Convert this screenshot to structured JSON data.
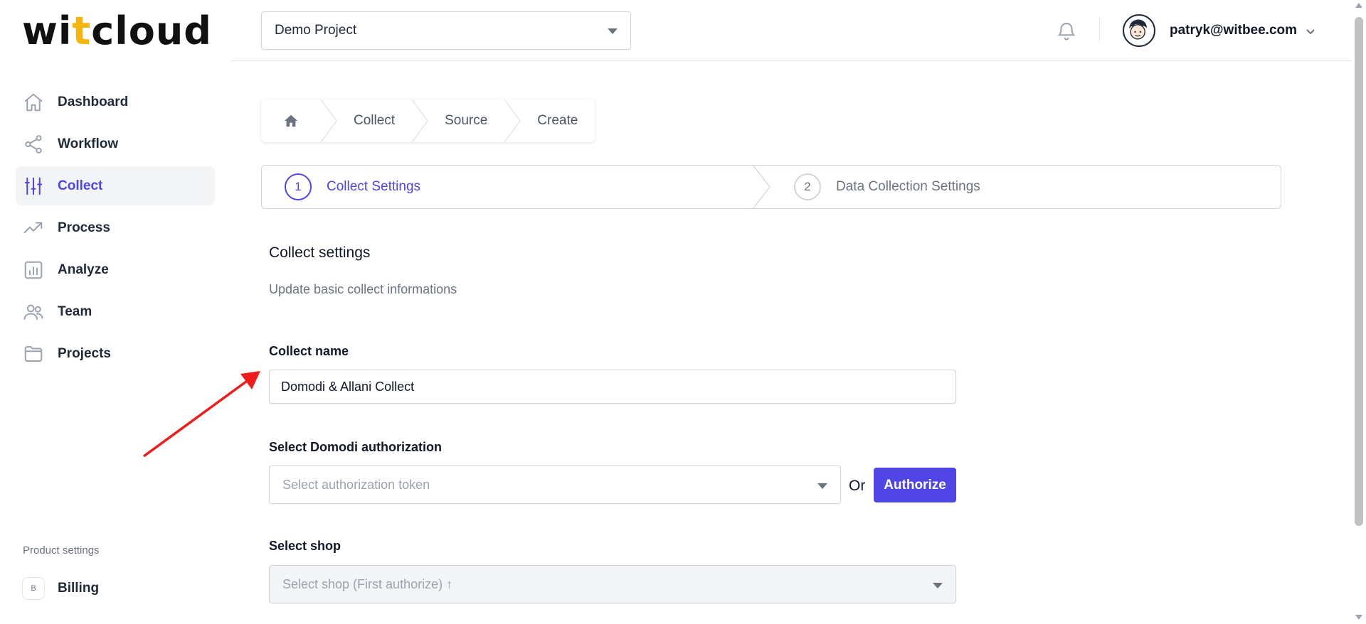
{
  "app": {
    "logo": {
      "prefix": "wi",
      "accent": "t",
      "suffix": "cloud"
    },
    "brand_color": "#4f46e5"
  },
  "header": {
    "project": "Demo Project",
    "user_email": "patryk@witbee.com"
  },
  "sidebar": {
    "items": [
      {
        "label": "Dashboard",
        "icon": "home-icon"
      },
      {
        "label": "Workflow",
        "icon": "share-icon"
      },
      {
        "label": "Collect",
        "icon": "sliders-icon",
        "active": true
      },
      {
        "label": "Process",
        "icon": "trending-up-icon"
      },
      {
        "label": "Analyze",
        "icon": "bar-chart-icon"
      },
      {
        "label": "Team",
        "icon": "users-icon"
      },
      {
        "label": "Projects",
        "icon": "folder-icon"
      }
    ],
    "product_settings_label": "Product settings",
    "billing": {
      "badge": "B",
      "label": "Billing"
    }
  },
  "breadcrumb": [
    "Collect",
    "Source",
    "Create"
  ],
  "steps": [
    {
      "number": "1",
      "label": "Collect Settings",
      "active": true
    },
    {
      "number": "2",
      "label": "Data Collection Settings",
      "active": false
    }
  ],
  "form": {
    "title": "Collect settings",
    "description": "Update basic collect informations",
    "collect_name_label": "Collect name",
    "collect_name_value": "Domodi & Allani Collect",
    "authorization_label": "Select Domodi authorization",
    "authorization_placeholder": "Select authorization token",
    "or_text": "Or",
    "authorize_button": "Authorize",
    "shop_label": "Select shop",
    "shop_placeholder": "Select shop (First authorize) ↑"
  }
}
